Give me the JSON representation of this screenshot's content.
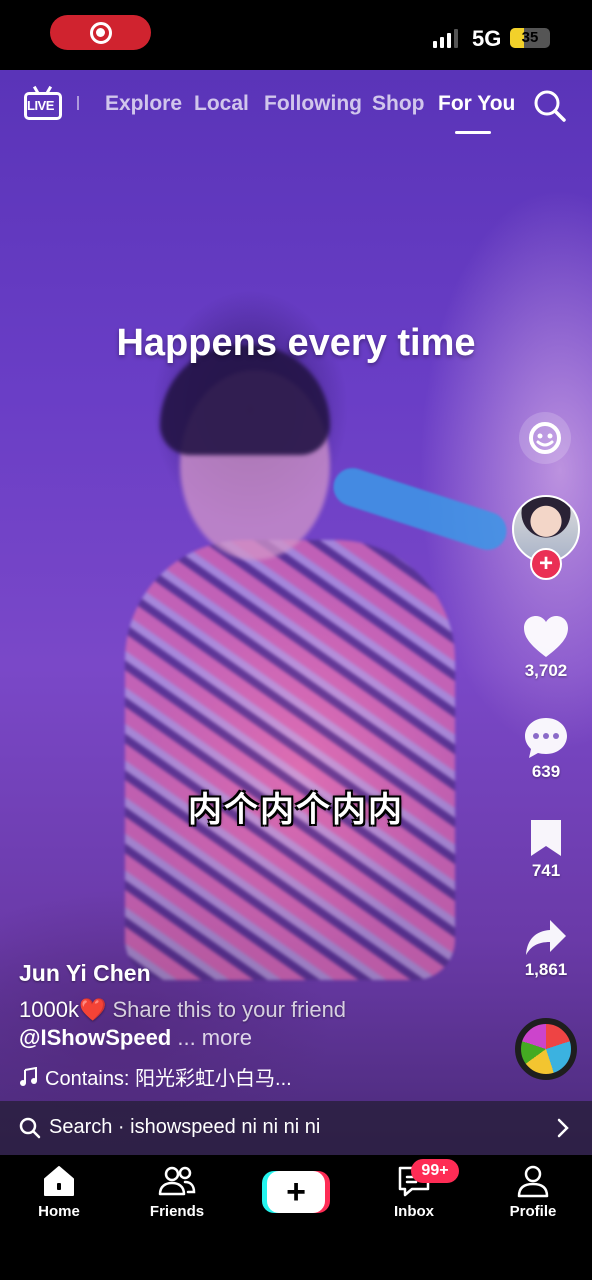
{
  "status_bar": {
    "network": "5G",
    "battery_text": "35",
    "battery_level": 0.35
  },
  "top_nav": {
    "live_label": "LIVE",
    "tabs": [
      {
        "label": "Explore",
        "active": false
      },
      {
        "label": "Local",
        "active": false
      },
      {
        "label": "Following",
        "active": false
      },
      {
        "label": "Shop",
        "active": false
      },
      {
        "label": "For You",
        "active": true
      }
    ]
  },
  "video": {
    "overlay_title": "Happens every time",
    "subtitle": "内个内个内内"
  },
  "actions": {
    "likes": "3,702",
    "comments": "639",
    "saves": "741",
    "shares": "1,861"
  },
  "post": {
    "author": "Jun Yi Chen",
    "caption_count": "1000k",
    "caption_text": " Share this to your friend",
    "mention": "@IShowSpeed",
    "more_label": " ... more",
    "sound": "Contains: 阳光彩虹小白马..."
  },
  "search_suggestion": {
    "text": "Search · ishowspeed ni ni ni ni"
  },
  "tab_bar": {
    "home": "Home",
    "friends": "Friends",
    "inbox": "Inbox",
    "inbox_badge": "99+",
    "profile": "Profile"
  },
  "colors": {
    "accent_red": "#fe2c55",
    "accent_cyan": "#25f4ee",
    "record_pill": "#d0232f",
    "battery_yellow": "#f2d12a"
  }
}
